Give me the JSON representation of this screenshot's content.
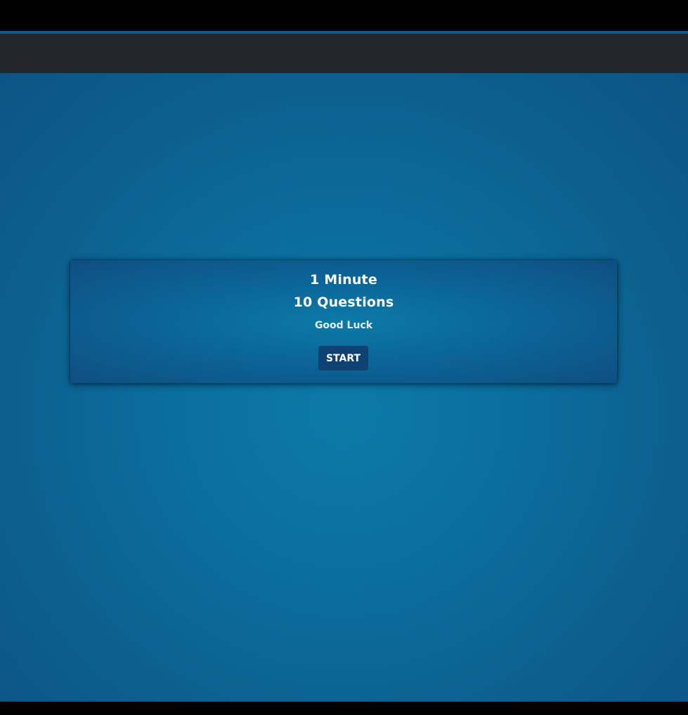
{
  "quiz": {
    "duration_label": "1 Minute",
    "questions_label": "10 Questions",
    "message": "Good Luck",
    "start_label": "START"
  },
  "colors": {
    "navbar": "#23262b",
    "accent": "#0e5c8e",
    "background_center": "#0c7aa8",
    "background_edge": "#0d5485",
    "button": "#0f4172",
    "text": "#ffffff"
  }
}
